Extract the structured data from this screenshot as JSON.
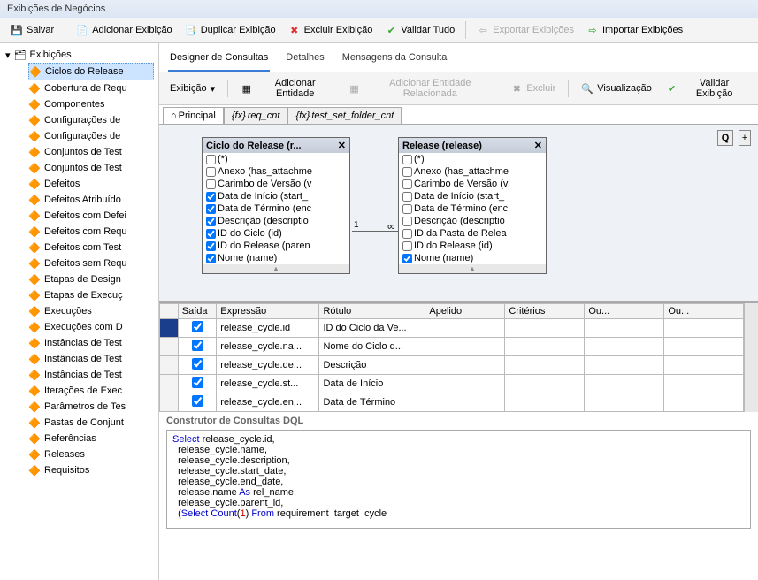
{
  "window": {
    "title": "Exibições de Negócios"
  },
  "toolbar": {
    "save": "Salvar",
    "add_view": "Adicionar Exibição",
    "dup_view": "Duplicar Exibição",
    "del_view": "Excluir Exibição",
    "validate_all": "Validar Tudo",
    "export_views": "Exportar Exibições",
    "import_views": "Importar Exibições"
  },
  "sidebar": {
    "root": "Exibições",
    "items": [
      "Ciclos do Release",
      "Cobertura de Requ",
      "Componentes",
      "Configurações de",
      "Configurações de",
      "Conjuntos de Test",
      "Conjuntos de Test",
      "Defeitos",
      "Defeitos Atribuído",
      "Defeitos com Defei",
      "Defeitos com Requ",
      "Defeitos com Test",
      "Defeitos sem Requ",
      "Etapas de Design",
      "Etapas de Execuç",
      "Execuções",
      "Execuções com D",
      "Instâncias de Test",
      "Instâncias de Test",
      "Instâncias de Test",
      "Iterações de Exec",
      "Parâmetros de Tes",
      "Pastas de Conjunt",
      "Referências",
      "Releases",
      "Requisitos"
    ]
  },
  "tabs": {
    "designer": "Designer de Consultas",
    "details": "Detalhes",
    "messages": "Mensagens da Consulta"
  },
  "subtoolbar": {
    "view": "Exibição",
    "add_entity": "Adicionar Entidade",
    "add_related": "Adicionar Entidade Relacionada",
    "delete": "Excluir",
    "preview": "Visualização",
    "validate_view": "Validar Exibição"
  },
  "subtabs": {
    "main": "Principal",
    "t1": "req_cnt",
    "t2": "test_set_folder_cnt"
  },
  "entities": {
    "left": {
      "title": "Ciclo do Release (r...",
      "fields": [
        {
          "c": false,
          "t": "(*)"
        },
        {
          "c": false,
          "t": "Anexo (has_attachme"
        },
        {
          "c": false,
          "t": "Carimbo de Versão (v"
        },
        {
          "c": true,
          "t": "Data de Início (start_"
        },
        {
          "c": true,
          "t": "Data de Término (enc"
        },
        {
          "c": true,
          "t": "Descrição (descriptio"
        },
        {
          "c": true,
          "t": "ID do Ciclo (id)"
        },
        {
          "c": true,
          "t": "ID do Release (paren"
        },
        {
          "c": true,
          "t": "Nome (name)"
        }
      ]
    },
    "right": {
      "title": "Release (release)",
      "fields": [
        {
          "c": false,
          "t": "(*)"
        },
        {
          "c": false,
          "t": "Anexo (has_attachme"
        },
        {
          "c": false,
          "t": "Carimbo de Versão (v"
        },
        {
          "c": false,
          "t": "Data de Início (start_"
        },
        {
          "c": false,
          "t": "Data de Término (enc"
        },
        {
          "c": false,
          "t": "Descrição (descriptio"
        },
        {
          "c": false,
          "t": "ID da Pasta de Relea"
        },
        {
          "c": false,
          "t": "ID do Release (id)"
        },
        {
          "c": true,
          "t": "Nome (name)"
        }
      ]
    },
    "rel": {
      "left": "1",
      "right": "∞"
    }
  },
  "grid": {
    "headers": {
      "out": "Saída",
      "expr": "Expressão",
      "label": "Rótulo",
      "alias": "Apelido",
      "crit": "Critérios",
      "or1": "Ou...",
      "or2": "Ou..."
    },
    "rows": [
      {
        "out": true,
        "expr": "release_cycle.id",
        "label": "ID do Ciclo da Ve..."
      },
      {
        "out": true,
        "expr": "release_cycle.na...",
        "label": "Nome do Ciclo d..."
      },
      {
        "out": true,
        "expr": "release_cycle.de...",
        "label": "Descrição"
      },
      {
        "out": true,
        "expr": "release_cycle.st...",
        "label": "Data de Início"
      },
      {
        "out": true,
        "expr": "release_cycle.en...",
        "label": "Data de Término"
      }
    ]
  },
  "dql": {
    "title": "Construtor de Consultas DQL",
    "lines": [
      {
        "pre": "",
        "kw": "Select",
        "rest": " release_cycle.id,"
      },
      {
        "pre": "  ",
        "rest": "release_cycle.name,"
      },
      {
        "pre": "  ",
        "rest": "release_cycle.description,"
      },
      {
        "pre": "  ",
        "rest": "release_cycle.start_date,"
      },
      {
        "pre": "  ",
        "rest": "release_cycle.end_date,"
      },
      {
        "pre": "  ",
        "rest": "release.name ",
        "kw2": "As",
        "rest2": " rel_name,"
      },
      {
        "pre": "  ",
        "rest": "release_cycle.parent_id,"
      },
      {
        "pre": "  (",
        "kw": "Select",
        "rest": " ",
        "kw2": "Count",
        "rest2": "(",
        "num": "1",
        "rest3": ") ",
        "kw3": "From",
        "rest4": " requirement  target  cycle"
      }
    ]
  },
  "chart_data": null
}
